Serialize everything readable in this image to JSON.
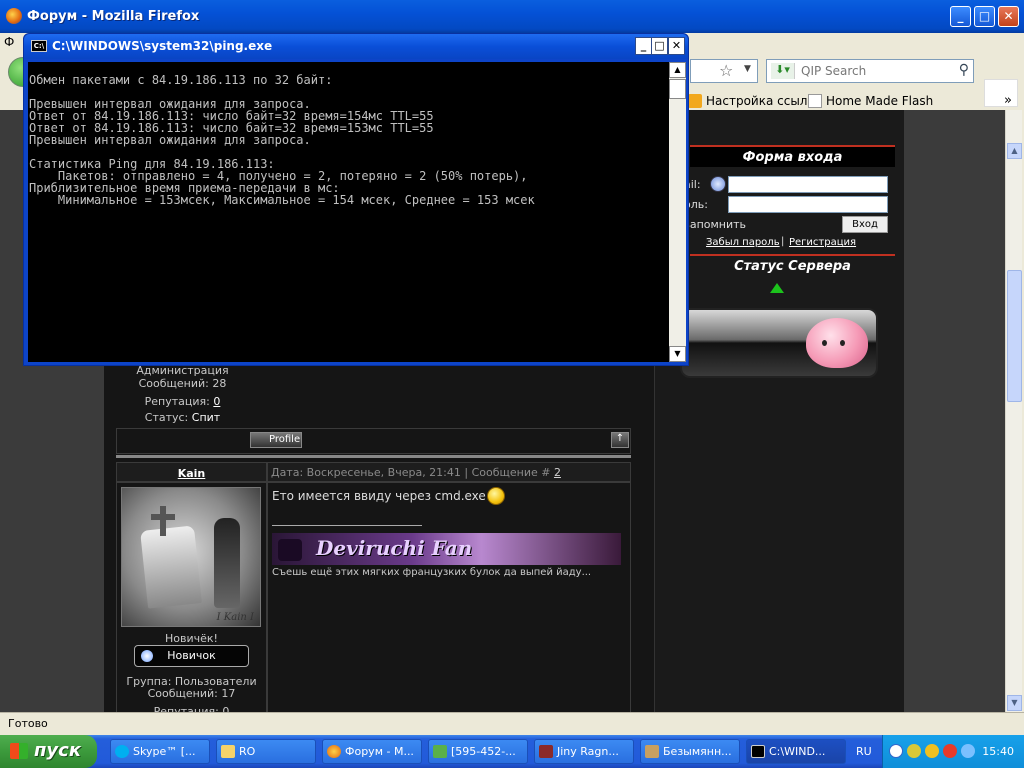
{
  "firefox": {
    "title": "Форум - Mozilla Firefox",
    "menu_visible": "Ф",
    "search_placeholder": "QIP Search",
    "bookmarks": [
      "Настройка ссылок",
      "Home Made Flash"
    ],
    "bookmarks_more": "»",
    "status": "Готово"
  },
  "console": {
    "title": "C:\\WINDOWS\\system32\\ping.exe",
    "icon_label": "C:\\",
    "lines": [
      "Обмен пакетами с 84.19.186.113 по 32 байт:",
      "",
      "Превышен интервал ожидания для запроса.",
      "Ответ от 84.19.186.113: число байт=32 время=154мс TTL=55",
      "Ответ от 84.19.186.113: число байт=32 время=153мс TTL=55",
      "Превышен интервал ожидания для запроса.",
      "",
      "Статистика Ping для 84.19.186.113:",
      "    Пакетов: отправлено = 4, получено = 2, потеряно = 2 (50% потерь),",
      "Приблизительное время приема-передачи в мс:",
      "    Минимальное = 153мсек, Максимальное = 154 мсек, Среднее = 153 мсек"
    ]
  },
  "sidebar": {
    "login_title": "Форма входа",
    "email_label": "ail:",
    "password_label": "оль:",
    "remember_label": "запомнить",
    "login_button": "Вход",
    "forgot_link": "Забыл пароль",
    "separator": "|",
    "register_link": "Регистрация",
    "status_title": "Статус Сервера"
  },
  "post1": {
    "group": "Администрация",
    "messages": "Сообщений: 28",
    "reputation_label": "Репутация:",
    "reputation_value": "0",
    "status_label": "Статус:",
    "status_value": "Спит",
    "profile_button": "Profile",
    "top_button": "↑"
  },
  "post2": {
    "author": "Kain",
    "header_prefix": "Дата: Воскресенье, Вчера, 21:41 | Сообщение #",
    "post_number": "2",
    "text": "Ето имеется ввиду через cmd.exe ?",
    "banner_text": "Deviruchi Fan",
    "signature": "Съешь ещё этих мягких французких булок да выпей йаду...",
    "avatar_signature": "I Kain I",
    "rank_title": "Новичёк!",
    "rank_badge": "Новичок",
    "group": "Группа: Пользователи",
    "messages": "Сообщений: 17",
    "reputation_partial": "Репутация: 0"
  },
  "taskbar": {
    "start_label": "пуск",
    "tasks": [
      "Skype™ [...",
      "RO",
      "Форум - М...",
      "[595-452-...",
      "Jiny Ragn...",
      "Безымянн...",
      "C:\\WIND..."
    ],
    "language": "RU",
    "clock": "15:40"
  },
  "colors": {
    "xp_blue": "#0451d6",
    "console_bg": "#000000",
    "console_text": "#c0c0c0",
    "forum_bg": "#151515",
    "accent_red": "#c03020"
  }
}
